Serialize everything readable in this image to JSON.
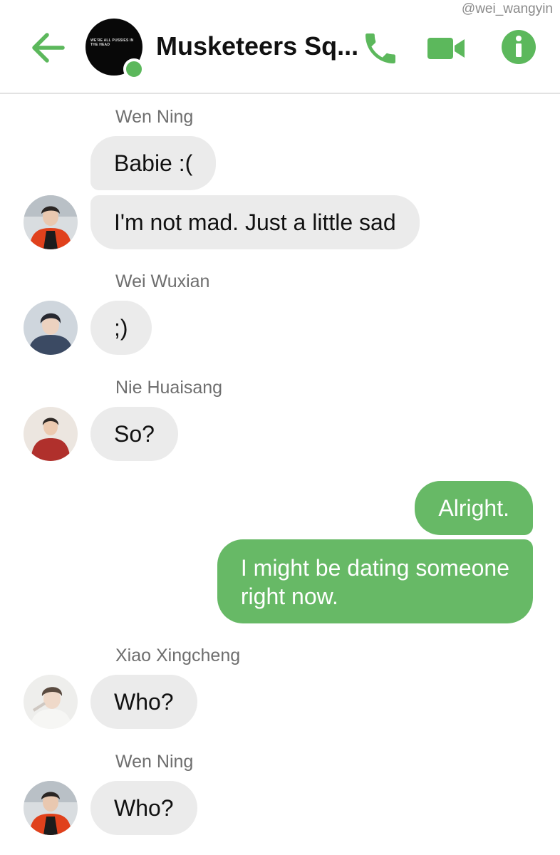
{
  "watermark": "@wei_wangyin",
  "header": {
    "title": "Musketeers Sq...",
    "avatar_text": "WE'RE ALL PUSSIES IN THE HEAD",
    "accent_color": "#5cb85c"
  },
  "messages": [
    {
      "sender": "Wen Ning",
      "bubbles": [
        "Babie :(",
        "I'm not mad. Just a little sad"
      ]
    },
    {
      "sender": "Wei Wuxian",
      "bubbles": [
        ";)"
      ]
    },
    {
      "sender": "Nie Huaisang",
      "bubbles": [
        "So?"
      ]
    },
    {
      "sender": "me",
      "bubbles": [
        "Alright.",
        "I might be dating someone",
        "right now."
      ]
    },
    {
      "sender": "Xiao Xingcheng",
      "bubbles": [
        "Who?"
      ]
    },
    {
      "sender": "Wen Ning",
      "bubbles": [
        "Who?"
      ]
    }
  ],
  "colors": {
    "outgoing_bubble": "#67b966",
    "incoming_bubble": "#ebebeb",
    "icon_green": "#5cb85c"
  }
}
